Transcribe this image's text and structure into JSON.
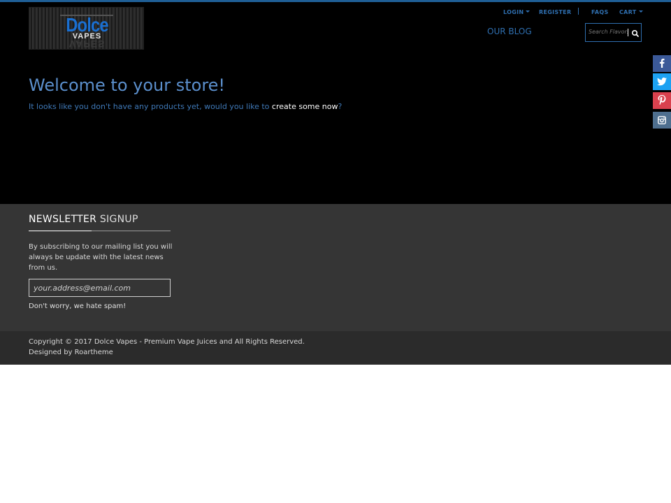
{
  "brand": {
    "logo_title": "Dolce",
    "logo_subtitle": "VAPES",
    "logo_reflection": "VAPES"
  },
  "topnav": {
    "login": "LOGIN",
    "register": "REGISTER",
    "faqs": "FAQS",
    "cart": "CART"
  },
  "mainnav": {
    "blog": "OUR BLOG"
  },
  "search": {
    "placeholder": "Search Flavors",
    "icon": "search-icon"
  },
  "hero": {
    "heading": "Welcome to your store!",
    "message_before": "It looks like you don't have any products yet, would you like to ",
    "message_link": "create some now",
    "message_after": "?"
  },
  "social": [
    {
      "icon": "facebook-icon",
      "color": "#3b5998"
    },
    {
      "icon": "twitter-icon",
      "color": "#1da1f2"
    },
    {
      "icon": "pinterest-icon",
      "color": "#d9414e"
    },
    {
      "icon": "instagram-icon",
      "color": "#4e6f8f"
    }
  ],
  "newsletter": {
    "title_strong": "NEWSLETTER",
    "title_light": " SIGNUP",
    "description": "By subscribing to our mailing list you will always be update with the latest news from us.",
    "email_placeholder": "your.address@email.com",
    "spam_note": "Don't worry, we hate spam!"
  },
  "footer": {
    "copyright": "Copyright © 2017 Dolce Vapes - Premium Vape Juices and All Rights Reserved.",
    "designed_by": "Designed by Roartheme"
  },
  "colors": {
    "accent": "#2f6fb0",
    "heading": "#5b8fcc",
    "hero_bg": "#000000",
    "footer_bg": "#353535",
    "copybar_bg": "#2b2b2b"
  }
}
